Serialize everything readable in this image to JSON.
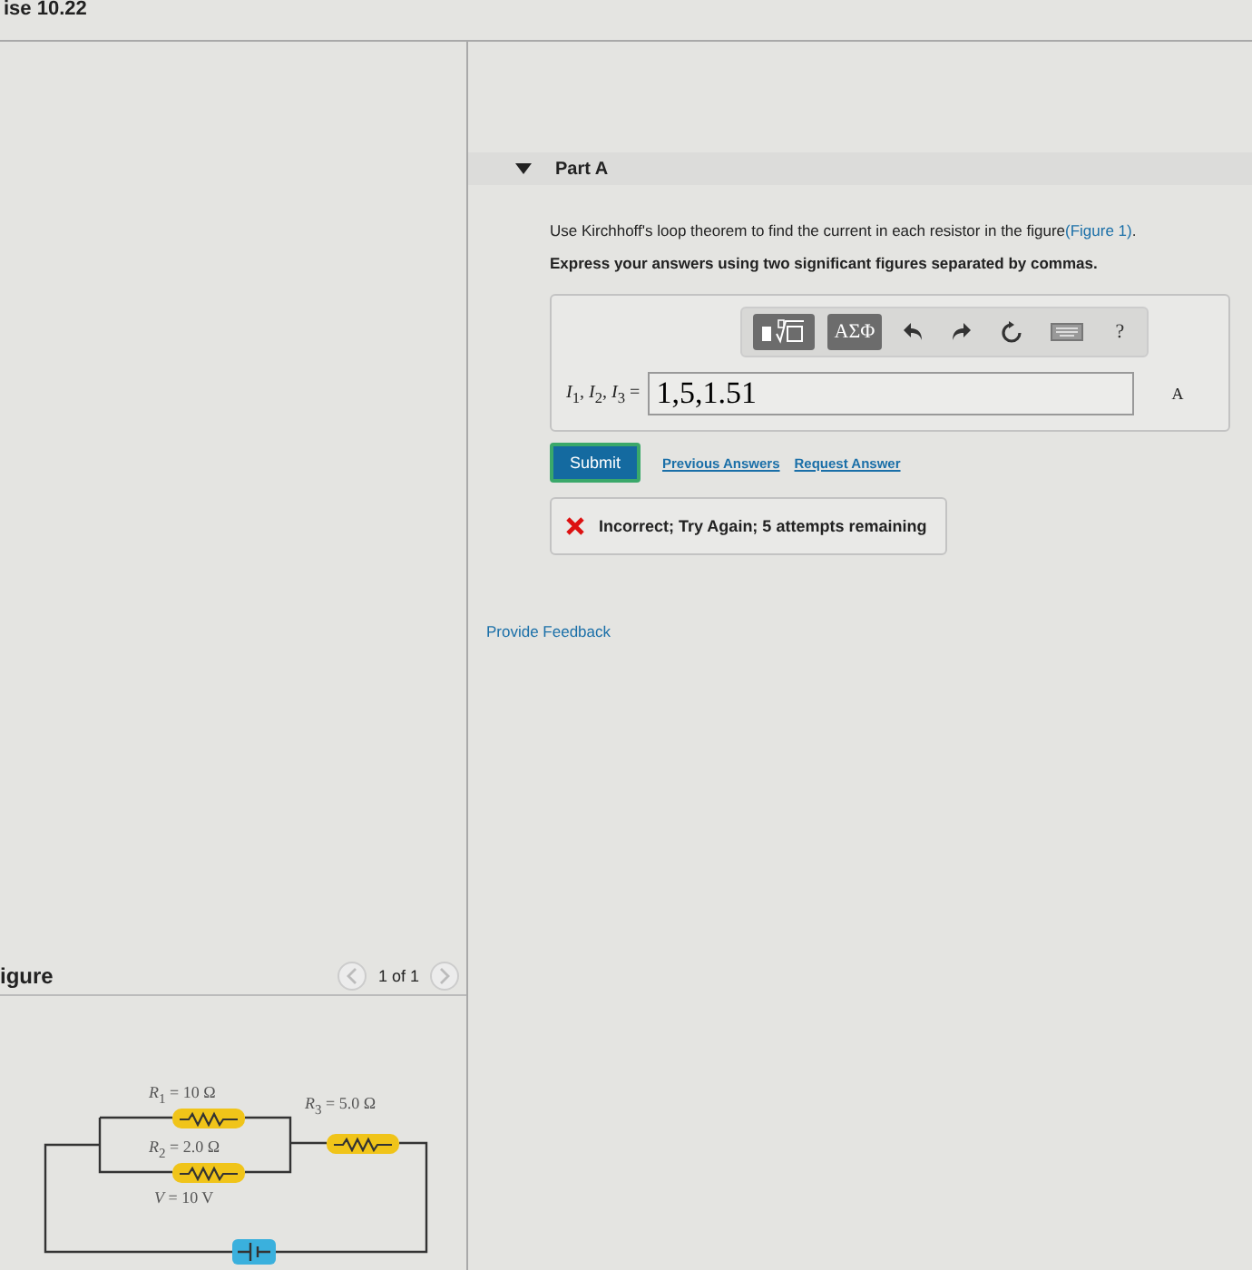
{
  "header": {
    "title": "ise 10.22"
  },
  "part": {
    "title": "Part A",
    "expanded": true,
    "instruction": "Use Kirchhoff's loop theorem to find the current in each resistor in the figure",
    "figure_link": "(Figure 1)",
    "instruction_end": ".",
    "emphasis": "Express your answers using two significant figures separated by commas.",
    "toolbar": [
      {
        "kind": "templates"
      },
      {
        "kind": "text",
        "label": "ΑΣΦ"
      },
      {
        "kind": "undo"
      },
      {
        "kind": "redo"
      },
      {
        "kind": "reset"
      },
      {
        "kind": "keyboard"
      },
      {
        "kind": "text",
        "label": "?"
      }
    ],
    "answer": {
      "label": "*I*$_{1}$, *I*$_{2}$, *I*$_{3}$ =",
      "value": "1,5,1.51",
      "unit": "A"
    },
    "submit": "Submit",
    "links": [
      "Previous Answers",
      "Request Answer"
    ],
    "feedback": {
      "correct": false,
      "message": "Incorrect; Try Again; 5 attempts remaining"
    }
  },
  "provide_feedback": "Provide Feedback",
  "figure": {
    "title": "igure",
    "pager": "1 of 1",
    "labels": [
      "*R*$_{1}$ = 10 Ω",
      "*R*$_{2}$ = 2.0 Ω",
      "*R*$_{3}$ = 5.0 Ω",
      "*V* = 10 V"
    ]
  }
}
